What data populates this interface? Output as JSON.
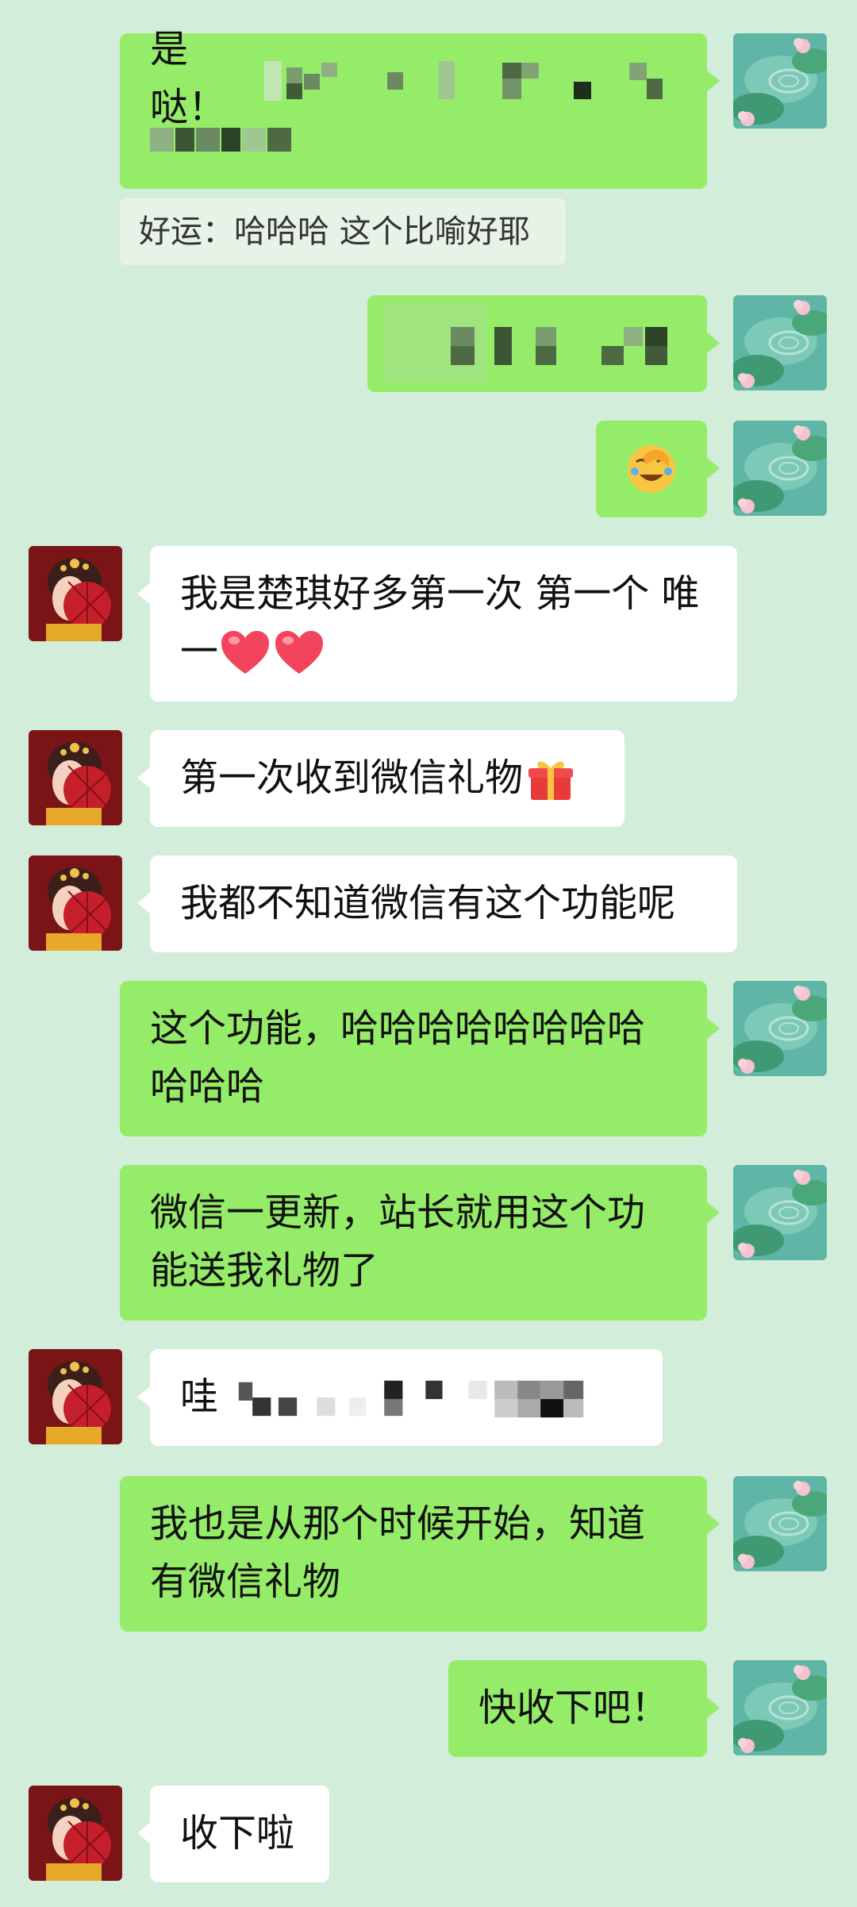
{
  "chat": {
    "messages": [
      {
        "side": "out",
        "text": "是哒！"
      },
      {
        "side": "quote",
        "text": "好运：哈哈哈 这个比喻好耶"
      },
      {
        "side": "out",
        "text": ""
      },
      {
        "side": "out",
        "emoji": "facepalm-laugh-emoji"
      },
      {
        "side": "in",
        "line1": "我是楚琪好多第一次 第一个 唯",
        "line2": "一"
      },
      {
        "side": "in",
        "text": "第一次收到微信礼物"
      },
      {
        "side": "in",
        "text": "我都不知道微信有这个功能呢"
      },
      {
        "side": "out",
        "line1": "这个功能，哈哈哈哈哈哈哈哈",
        "line2": "哈哈哈"
      },
      {
        "side": "out",
        "line1": "微信一更新，站长就用这个功",
        "line2": "能送我礼物了"
      },
      {
        "side": "in",
        "text": "哇"
      },
      {
        "side": "out",
        "line1": "我也是从那个时候开始，知道",
        "line2": "有微信礼物"
      },
      {
        "side": "out",
        "text": "快收下吧！"
      },
      {
        "side": "in",
        "text": "收下啦"
      }
    ]
  },
  "colors": {
    "background": "#d2edd9",
    "outgoing_bubble": "#95ec69",
    "incoming_bubble": "#ffffff",
    "quote_bubble": "#e6f3e6",
    "heart": "#f2445c",
    "avatar_bg": "#7a1416"
  },
  "icons": {
    "heart": "heart-emoji",
    "gift": "gift-emoji",
    "facepalm": "facepalm-laugh-emoji"
  }
}
